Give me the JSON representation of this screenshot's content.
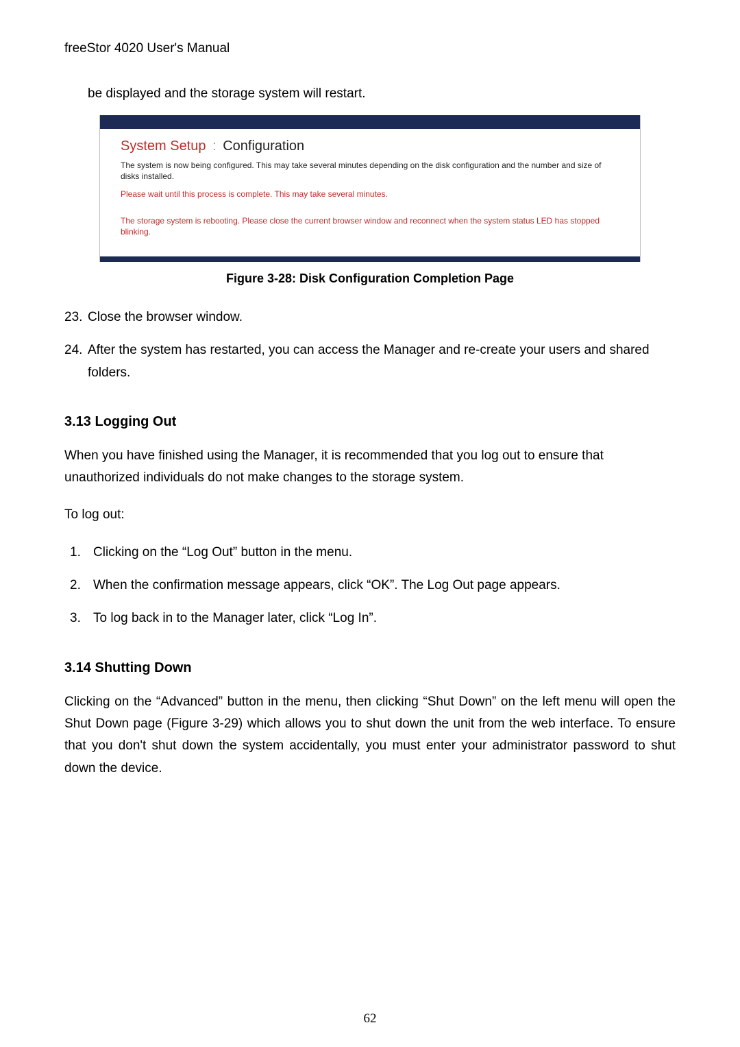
{
  "header": {
    "title": "freeStor 4020 User's Manual"
  },
  "continued": "be displayed and the storage system will restart.",
  "figure": {
    "title_red": "System Setup",
    "title_sep": ":",
    "title_black": "Configuration",
    "line1": "The system is now being configured. This may take several minutes depending on the disk configuration and the number and size of disks installed.",
    "line2": "Please wait until this process is complete. This may take several minutes.",
    "line3": "The storage system is rebooting. Please close the current browser window and reconnect when the system status LED has stopped blinking.",
    "caption": "Figure 3-28: Disk Configuration Completion Page"
  },
  "steps_after_figure": [
    {
      "num": "23.",
      "text": "Close the browser window."
    },
    {
      "num": "24.",
      "text": "After the system has restarted, you can access the Manager and re-create your users and shared folders."
    }
  ],
  "section_logout": {
    "heading": "3.13  Logging Out",
    "p1": "When you have finished using the Manager, it is recommended that you log out to ensure that unauthorized individuals do not make changes to the storage system.",
    "p2": "To log out:",
    "items": [
      {
        "num": "1.",
        "text": "Clicking on the “Log Out” button in the menu."
      },
      {
        "num": "2.",
        "text": "When the confirmation message appears, click “OK”. The Log Out page appears."
      },
      {
        "num": "3.",
        "text": "To log back in to the Manager later, click “Log In”."
      }
    ]
  },
  "section_shutdown": {
    "heading": "3.14  Shutting Down",
    "p1": "Clicking on the “Advanced” button in the menu, then clicking “Shut Down” on the left menu will open the Shut Down page (Figure 3-29) which allows you to shut down the unit from the web interface. To ensure that you don't shut down the system accidentally, you must enter your administrator password to shut down the device."
  },
  "page_number": "62"
}
